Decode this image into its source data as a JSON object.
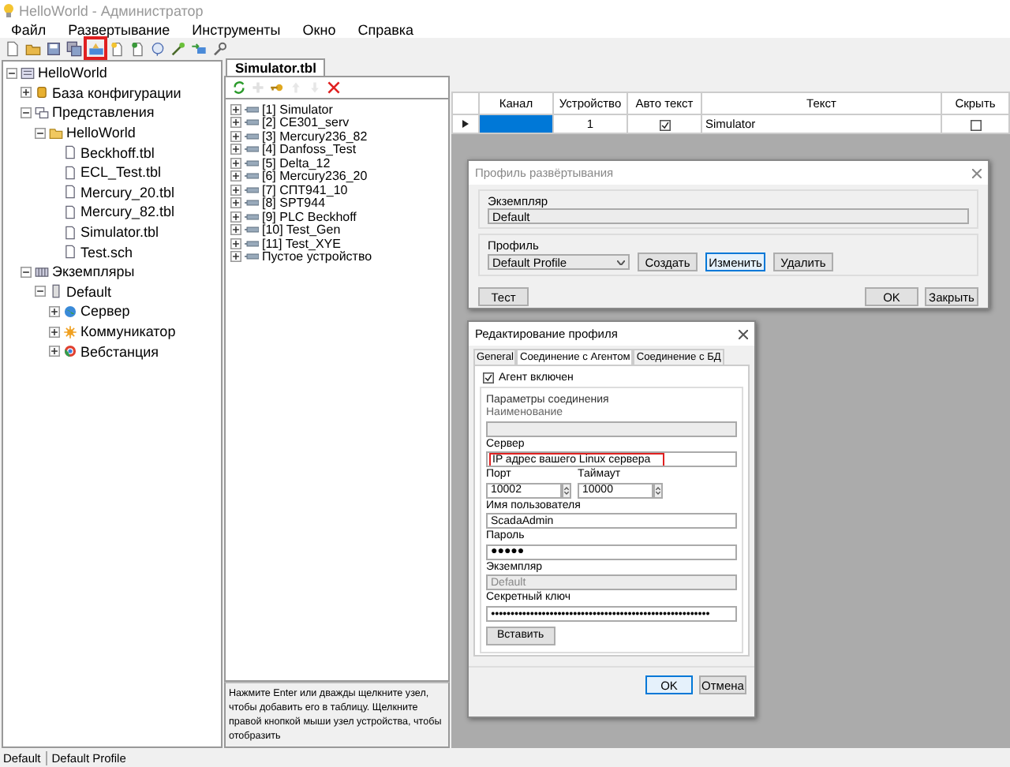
{
  "window": {
    "title": "HelloWorld - Администратор"
  },
  "menu": [
    "Файл",
    "Развертывание",
    "Инструменты",
    "Окно",
    "Справка"
  ],
  "toolbar": [
    {
      "kind": "new",
      "highlighted": false
    },
    {
      "kind": "open",
      "highlighted": false
    },
    {
      "kind": "save",
      "highlighted": false
    },
    {
      "kind": "save-all",
      "highlighted": false
    },
    {
      "kind": "deploy",
      "highlighted": true
    },
    {
      "kind": "start",
      "highlighted": false
    },
    {
      "kind": "stop",
      "highlighted": false
    },
    {
      "kind": "restart",
      "highlighted": false
    },
    {
      "kind": "wand",
      "highlighted": false
    },
    {
      "kind": "import",
      "highlighted": false
    },
    {
      "kind": "tools",
      "highlighted": false
    }
  ],
  "explorer": [
    {
      "label": "HelloWorld",
      "kind": "project",
      "expanded": true,
      "children": [
        {
          "label": "База конфигурации",
          "kind": "database",
          "expanded": false
        },
        {
          "label": "Представления",
          "kind": "views",
          "expanded": true,
          "children": [
            {
              "label": "HelloWorld",
              "kind": "folder",
              "expanded": true,
              "children": [
                {
                  "label": "Beckhoff.tbl",
                  "kind": "file"
                },
                {
                  "label": "ECL_Test.tbl",
                  "kind": "file"
                },
                {
                  "label": "Mercury_20.tbl",
                  "kind": "file"
                },
                {
                  "label": "Mercury_82.tbl",
                  "kind": "file"
                },
                {
                  "label": "Simulator.tbl",
                  "kind": "file"
                },
                {
                  "label": "Test.sch",
                  "kind": "file"
                }
              ]
            }
          ]
        },
        {
          "label": "Экземпляры",
          "kind": "instances",
          "expanded": true,
          "children": [
            {
              "label": "Default",
              "kind": "instance",
              "expanded": true,
              "children": [
                {
                  "label": "Сервер",
                  "kind": "server",
                  "expanded": false
                },
                {
                  "label": "Коммуникатор",
                  "kind": "communicator",
                  "expanded": false
                },
                {
                  "label": "Вебстанция",
                  "kind": "web",
                  "expanded": false
                }
              ]
            }
          ]
        }
      ]
    }
  ],
  "editor": {
    "tabs": [
      {
        "label": "Simulator.tbl",
        "selected": true
      }
    ],
    "toolbar": [
      {
        "kind": "refresh",
        "disabled": false
      },
      {
        "kind": "add",
        "disabled": true
      },
      {
        "kind": "key",
        "disabled": false
      },
      {
        "kind": "up",
        "disabled": true
      },
      {
        "kind": "down",
        "disabled": true
      },
      {
        "kind": "delete",
        "disabled": false
      }
    ],
    "devices": [
      {
        "label": "[1] Simulator",
        "expanded": false
      },
      {
        "label": "[2] CE301_serv",
        "expanded": false
      },
      {
        "label": "[3] Mercury236_82",
        "expanded": false
      },
      {
        "label": "[4] Danfoss_Test",
        "expanded": false
      },
      {
        "label": "[5] Delta_12",
        "expanded": false
      },
      {
        "label": "[6] Mercury236_20",
        "expanded": false
      },
      {
        "label": "[7] СПТ941_10",
        "expanded": false
      },
      {
        "label": "[8] SPT944",
        "expanded": false
      },
      {
        "label": "[9] PLC Beckhoff",
        "expanded": false
      },
      {
        "label": "[10] Test_Gen",
        "expanded": false
      },
      {
        "label": "[11] Test_XYE",
        "expanded": false
      },
      {
        "label": "Пустое устройство",
        "expanded": false
      }
    ],
    "hint": "Нажмите Enter или дважды щелкните узел, чтобы добавить его в таблицу. Щелкните правой кнопкой мыши узел устройства, чтобы отобразить"
  },
  "table": {
    "columns": [
      "Канал",
      "Устройство",
      "Авто текст",
      "Текст",
      "Скрыть"
    ],
    "rows": [
      {
        "selected": true,
        "device": "1",
        "auto_text": true,
        "text": "Simulator",
        "hide": false
      }
    ]
  },
  "deploy_dialog": {
    "title": "Профиль развёртывания",
    "instance_label": "Экземпляр",
    "instance": "Default",
    "profile_label": "Профиль",
    "profile": "Default Profile",
    "buttons": [
      {
        "label": "Создать",
        "focused": false
      },
      {
        "label": "Изменить",
        "focused": true
      },
      {
        "label": "Удалить",
        "focused": false
      }
    ],
    "test_button": "Тест",
    "footer_buttons": [
      "OK",
      "Закрыть"
    ]
  },
  "profile_dialog": {
    "title": "Редактирование профиля",
    "tabs": [
      {
        "label": "General",
        "selected": false
      },
      {
        "label": "Соединение с Агентом",
        "selected": true
      },
      {
        "label": "Соединение с БД",
        "selected": false
      }
    ],
    "agent_enabled": {
      "label": "Агент включен",
      "checked": true
    },
    "group": "Параметры соединения",
    "name_label": "Наименование",
    "server": {
      "label": "Сервер",
      "value": "IP адрес вашего Linux сервера",
      "highlighted": true
    },
    "port": {
      "label": "Порт",
      "value": "10002"
    },
    "timeout": {
      "label": "Таймаут",
      "value": "10000"
    },
    "username": {
      "label": "Имя пользователя",
      "value": "ScadaAdmin"
    },
    "password": {
      "label": "Пароль",
      "value": "●●●●●"
    },
    "instance": {
      "label": "Экземпляр",
      "value": "Default",
      "disabled": true
    },
    "secret": {
      "label": "Секретный ключ",
      "value": "●●●●●●●●●●●●●●●●●●●●●●●●●●●●●●●●●●●●●●●●●●●●●●●●●●●●●●●●"
    },
    "paste_button": "Вставить",
    "footer_buttons": [
      {
        "label": "OK",
        "focused": true
      },
      {
        "label": "Отмена",
        "focused": false
      }
    ]
  },
  "status_bar": [
    "Default",
    "Default Profile"
  ]
}
